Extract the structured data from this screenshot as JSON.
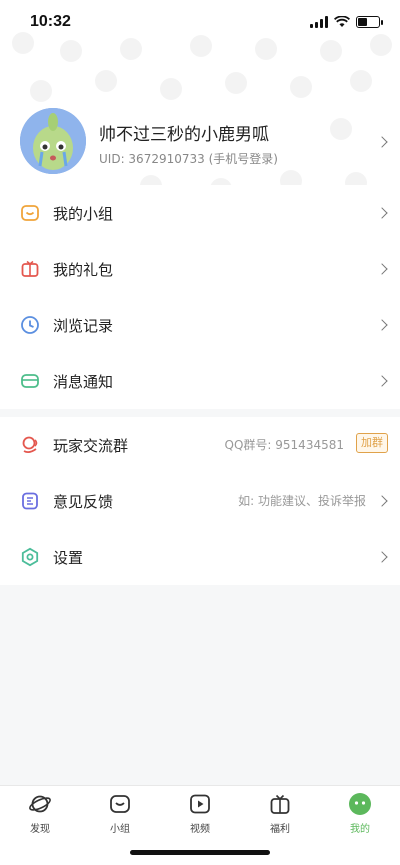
{
  "status_bar": {
    "time": "10:32"
  },
  "profile": {
    "name": "帅不过三秒的小鹿男呱",
    "uid": "UID: 3672910733 (手机号登录)"
  },
  "menu": {
    "group1": [
      {
        "label": "我的小组",
        "icon": "group-icon"
      },
      {
        "label": "我的礼包",
        "icon": "gift-icon"
      },
      {
        "label": "浏览记录",
        "icon": "clock-icon"
      },
      {
        "label": "消息通知",
        "icon": "message-icon"
      }
    ],
    "group2": [
      {
        "label": "玩家交流群",
        "icon": "chat-group-icon",
        "right_text": "QQ群号: 951434581",
        "badge": "加群"
      },
      {
        "label": "意见反馈",
        "icon": "feedback-icon",
        "right_text": "如: 功能建议、投诉举报"
      },
      {
        "label": "设置",
        "icon": "settings-icon"
      }
    ]
  },
  "tabs": [
    {
      "label": "发现",
      "icon": "planet-icon"
    },
    {
      "label": "小组",
      "icon": "group-tab-icon"
    },
    {
      "label": "视频",
      "icon": "video-icon"
    },
    {
      "label": "福利",
      "icon": "gift-tab-icon"
    },
    {
      "label": "我的",
      "icon": "me-icon",
      "active": true
    }
  ],
  "colors": {
    "accent_green": "#5cb85c",
    "badge_orange": "#e0a24a"
  }
}
